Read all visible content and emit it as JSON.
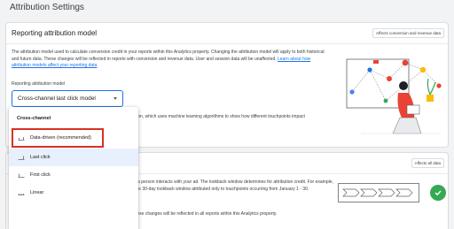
{
  "page": {
    "title": "Attribution Settings"
  },
  "card1": {
    "title": "Reporting attribution model",
    "chip": "Affects conversion and revenue data",
    "desc_main": "The attribution model used to calculate conversion credit in your reports within this Analytics property. Changing the attribution model will apply to both historical and future data. These changes will be reflected in reports with conversion and revenue data. User and session data will be unaffected. ",
    "desc_link": "Learn about how attribution models affect your reporting data",
    "field_label": "Reporting attribution model",
    "select_value": "Cross-channel last click model",
    "under_text": "ation, which uses machine learning algorithms to show how different touchpoints impact"
  },
  "card2": {
    "chip": "Affects all data",
    "text1": "r a person interacts with your ad. The lookback window determines for attribution credit. For example, the 30-day lookback window attributed only to touchpoints occurring from January 1 - 30.",
    "text2": "Changing the lookback window will only apply going forward. These changes will be reflected in all reports within this Analytics property."
  },
  "menu": {
    "section": "Cross-channel",
    "items": [
      {
        "label": "Data-driven (recommended)",
        "icon": "bar-chart-icon"
      },
      {
        "label": "Last click",
        "icon": "last-click-icon"
      },
      {
        "label": "First click",
        "icon": "first-click-icon"
      },
      {
        "label": "Linear",
        "icon": "linear-icon"
      }
    ]
  },
  "colors": {
    "accent": "#1a73e8",
    "highlight": "#d93025",
    "selected_bg": "#e8f0fe",
    "success": "#34a853"
  }
}
